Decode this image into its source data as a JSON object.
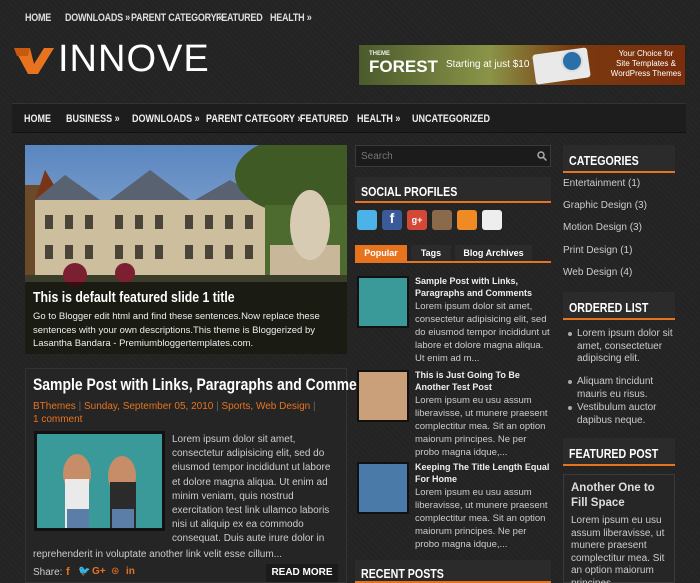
{
  "top_nav": {
    "items": [
      {
        "label": "HOME"
      },
      {
        "label": "DOWNLOADS »"
      },
      {
        "label": "PARENT CATEGORY »"
      },
      {
        "label": "FEATURED"
      },
      {
        "label": "HEALTH »"
      }
    ]
  },
  "logo": {
    "text": "INNOVE"
  },
  "ad": {
    "brand": "FOREST",
    "brand_prefix": "THEME",
    "offer": "Starting at just $10",
    "tagline_1": "Your Choice for",
    "tagline_2": "Site Templates &",
    "tagline_3": "WordPress Themes"
  },
  "main_nav": {
    "items": [
      {
        "label": "HOME"
      },
      {
        "label": "BUSINESS »"
      },
      {
        "label": "DOWNLOADS »"
      },
      {
        "label": "PARENT CATEGORY »"
      },
      {
        "label": "FEATURED"
      },
      {
        "label": "HEALTH »"
      },
      {
        "label": "UNCATEGORIZED"
      }
    ]
  },
  "slider": {
    "title": "This is default featured slide 1 title",
    "text": "Go to Blogger edit html and find these sentences.Now replace these sentences with your own descriptions.This theme is Bloggerized by Lasantha Bandara - Premiumbloggertemplates.com."
  },
  "post": {
    "title": "Sample Post with Links, Paragraphs and Comments",
    "author": "BThemes",
    "date": "Sunday, September 05, 2010",
    "labels": "Sports, Web Design",
    "comments": "1 comment",
    "excerpt": "Lorem ipsum dolor sit amet, consectetur adipisicing elit, sed do eiusmod tempor incididunt ut labore et dolore magna aliqua. Ut enim ad minim veniam, quis nostrud exercitation test link ullamco laboris nisi ut aliquip ex ea commodo consequat. Duis aute irure dolor in",
    "excerpt_end": "reprehenderit in voluptate another link velit esse cillum...",
    "share_label": "Share:",
    "read_more": "READ MORE"
  },
  "search": {
    "placeholder": "Search"
  },
  "social": {
    "heading": "SOCIAL PROFILES"
  },
  "tabs": {
    "popular": "Popular",
    "tags": "Tags",
    "archives": "Blog Archives"
  },
  "popular_posts": [
    {
      "title": "Sample Post with Links, Paragraphs and Comments",
      "excerpt": "Lorem ipsum dolor sit amet, consectetur adipisicing elit, sed do eiusmod tempor incididunt ut labore et dolore magna aliqua. Ut enim ad m..."
    },
    {
      "title": "This is Just Going To Be Another Test Post",
      "excerpt": "Lorem ipsum eu usu assum liberavisse, ut munere praesent complectitur mea. Sit an option maiorum principes. Ne per probo magna idque,..."
    },
    {
      "title": "Keeping The Title Length Equal For Home",
      "excerpt": "Lorem ipsum eu usu assum liberavisse, ut munere praesent complectitur mea. Sit an option maiorum principes. Ne per probo magna idque,..."
    }
  ],
  "recent_posts": {
    "heading": "RECENT POSTS"
  },
  "categories": {
    "heading": "CATEGORIES",
    "items": [
      {
        "label": "Entertainment (1)"
      },
      {
        "label": "Graphic Design (3)"
      },
      {
        "label": "Motion Design (3)"
      },
      {
        "label": "Print Design (1)"
      },
      {
        "label": "Web Design (4)"
      }
    ]
  },
  "ordered_list": {
    "heading": "ORDERED LIST",
    "items": [
      {
        "label": "Lorem ipsum dolor sit amet, consectetuer adipiscing elit."
      },
      {
        "label": "Aliquam tincidunt mauris eu risus."
      },
      {
        "label": "Vestibulum auctor dapibus neque."
      }
    ]
  },
  "featured_post": {
    "heading": "FEATURED POST",
    "title": "Another One to Fill Space",
    "excerpt": "Lorem ipsum eu usu assum liberavisse, ut munere praesent complectitur mea. Sit an option maiorum principes."
  },
  "colors": {
    "accent": "#e8731f",
    "background": "#232323",
    "widget_header": "#2b2b2b"
  }
}
